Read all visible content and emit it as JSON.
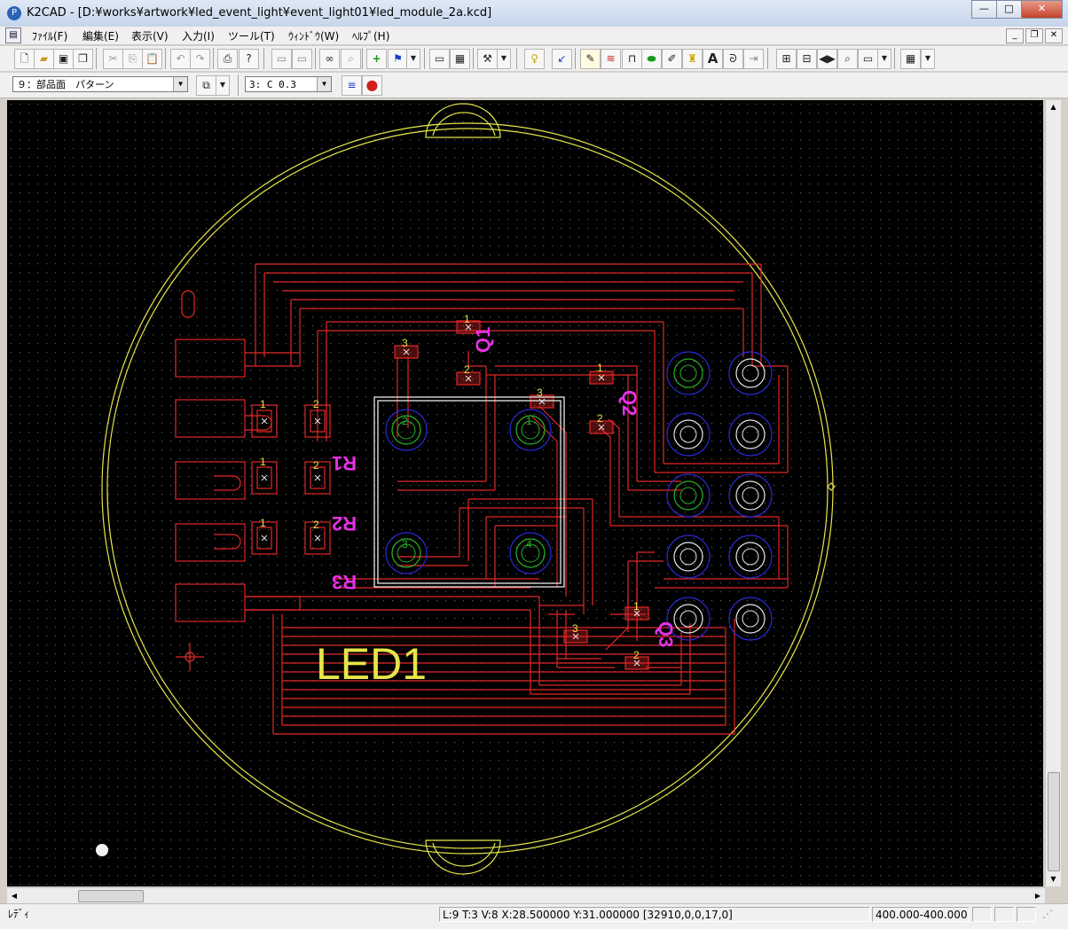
{
  "window": {
    "title": "K2CAD - [D:¥works¥artwork¥led_event_light¥event_light01¥led_module_2a.kcd]",
    "app_icon": "k2cad-app-icon",
    "controls": {
      "minimize": "—",
      "maximize": "□",
      "close": "✕"
    }
  },
  "menubar": {
    "items": [
      {
        "label": "ﾌｧｲﾙ(F)"
      },
      {
        "label": "編集(E)"
      },
      {
        "label": "表示(V)"
      },
      {
        "label": "入力(I)"
      },
      {
        "label": "ツール(T)"
      },
      {
        "label": "ｳｨﾝﾄﾞｳ(W)"
      },
      {
        "label": "ﾍﾙﾌﾟ(H)"
      }
    ],
    "mdi_controls": {
      "minimize": "_",
      "restore": "❐",
      "close": "✕"
    }
  },
  "toolbar2": {
    "layer_select": "９：部品面　パターン",
    "line_select": "3: C 0.3"
  },
  "canvas": {
    "labels": {
      "led1": "LED1",
      "r1": "R1",
      "r2": "R2",
      "r3": "R3",
      "q1": "Q1",
      "q2": "Q2",
      "q3": "Q3"
    },
    "pin_labels": {
      "one": "1",
      "two": "2",
      "three": "3",
      "four": "4"
    },
    "colors": {
      "background": "#000000",
      "grid": "#5a5a5a",
      "outline": "#e6e64a",
      "trace": "#e32727",
      "pad_ring": "#2a2ad8",
      "pad_inner": "#27b427",
      "silk_white": "#e8e8e8",
      "ref_magenta": "#e431e4",
      "pin_num": "#e6e64a"
    }
  },
  "statusbar": {
    "state": "ﾚﾃﾞｨ",
    "coords": "L:9 T:3 V:8 X:28.500000 Y:31.000000 [32910,0,0,17,0]",
    "zoom": "400.000-400.000"
  }
}
